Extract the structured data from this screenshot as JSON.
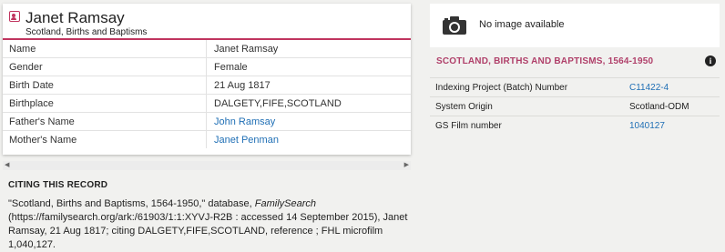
{
  "record": {
    "name": "Janet Ramsay",
    "collection": "Scotland, Births and Baptisms",
    "facts": [
      {
        "label": "Name",
        "value": "Janet Ramsay"
      },
      {
        "label": "Gender",
        "value": "Female"
      },
      {
        "label": "Birth Date",
        "value": "21 Aug 1817"
      },
      {
        "label": "Birthplace",
        "value": "DALGETY,FIFE,SCOTLAND"
      },
      {
        "label": "Father's Name",
        "value": "John Ramsay"
      },
      {
        "label": "Mother's Name",
        "value": "Janet Penman"
      }
    ]
  },
  "citing": {
    "title": "CITING THIS RECORD",
    "text_part1": "\"Scotland, Births and Baptisms, 1564-1950,\" database, ",
    "text_italic": "FamilySearch",
    "text_part2": " (https://familysearch.org/ark:/61903/1:1:XYVJ-R2B : accessed 14 September 2015), Janet Ramsay, 21 Aug 1817; citing DALGETY,FIFE,SCOTLAND, reference ; FHL microfilm 1,040,127."
  },
  "image": {
    "no_image_text": "No image available",
    "icon": "camera-icon"
  },
  "collection_details": {
    "title": "SCOTLAND, BIRTHS AND BAPTISMS, 1564-1950",
    "rows": [
      {
        "label": "Indexing Project (Batch) Number",
        "value": "C11422-4"
      },
      {
        "label": "System Origin",
        "value": "Scotland-ODM"
      },
      {
        "label": "GS Film number",
        "value": "1040127"
      }
    ]
  },
  "colors": {
    "accent": "#c0355f",
    "collection_title": "#b0406a",
    "link": "#1f6fb5"
  }
}
